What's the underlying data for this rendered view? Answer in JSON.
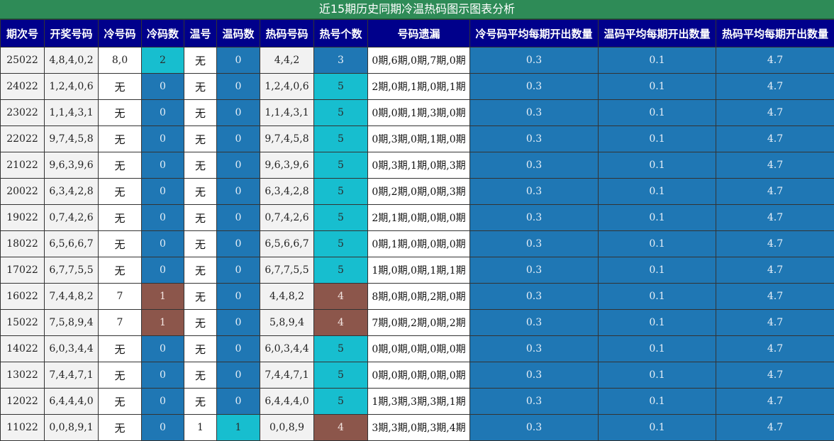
{
  "title": "近15期历史同期冷温热码图示图表分析",
  "colors": {
    "title_bg": "#2e8b57",
    "header_bg": "#00008b",
    "blue": "#1f77b4",
    "cyan": "#17becf",
    "brown": "#8c564b"
  },
  "headers": [
    "期次号",
    "开奖号码",
    "冷号码",
    "冷码数",
    "温号",
    "温码数",
    "热码号码",
    "热号个数",
    "号码遗漏",
    "冷号码平均每期开出数量",
    "温码平均每期开出数量",
    "热码平均每期开出数量"
  ],
  "rows": [
    {
      "issue": "25022",
      "numbers": "4,8,4,0,2",
      "cold": "8,0",
      "cold_count": "2",
      "warm": "无",
      "warm_count": "0",
      "hot": "4,4,2",
      "hot_count": "3",
      "missing": "0期,6期,0期,7期,0期",
      "avg_cold": "0.3",
      "avg_warm": "0.1",
      "avg_hot": "4.7"
    },
    {
      "issue": "24022",
      "numbers": "1,2,4,0,6",
      "cold": "无",
      "cold_count": "0",
      "warm": "无",
      "warm_count": "0",
      "hot": "1,2,4,0,6",
      "hot_count": "5",
      "missing": "2期,0期,1期,0期,1期",
      "avg_cold": "0.3",
      "avg_warm": "0.1",
      "avg_hot": "4.7"
    },
    {
      "issue": "23022",
      "numbers": "1,1,4,3,1",
      "cold": "无",
      "cold_count": "0",
      "warm": "无",
      "warm_count": "0",
      "hot": "1,1,4,3,1",
      "hot_count": "5",
      "missing": "0期,0期,1期,3期,0期",
      "avg_cold": "0.3",
      "avg_warm": "0.1",
      "avg_hot": "4.7"
    },
    {
      "issue": "22022",
      "numbers": "9,7,4,5,8",
      "cold": "无",
      "cold_count": "0",
      "warm": "无",
      "warm_count": "0",
      "hot": "9,7,4,5,8",
      "hot_count": "5",
      "missing": "0期,3期,0期,1期,0期",
      "avg_cold": "0.3",
      "avg_warm": "0.1",
      "avg_hot": "4.7"
    },
    {
      "issue": "21022",
      "numbers": "9,6,3,9,6",
      "cold": "无",
      "cold_count": "0",
      "warm": "无",
      "warm_count": "0",
      "hot": "9,6,3,9,6",
      "hot_count": "5",
      "missing": "0期,3期,1期,0期,3期",
      "avg_cold": "0.3",
      "avg_warm": "0.1",
      "avg_hot": "4.7"
    },
    {
      "issue": "20022",
      "numbers": "6,3,4,2,8",
      "cold": "无",
      "cold_count": "0",
      "warm": "无",
      "warm_count": "0",
      "hot": "6,3,4,2,8",
      "hot_count": "5",
      "missing": "0期,2期,0期,0期,3期",
      "avg_cold": "0.3",
      "avg_warm": "0.1",
      "avg_hot": "4.7"
    },
    {
      "issue": "19022",
      "numbers": "0,7,4,2,6",
      "cold": "无",
      "cold_count": "0",
      "warm": "无",
      "warm_count": "0",
      "hot": "0,7,4,2,6",
      "hot_count": "5",
      "missing": "2期,1期,0期,0期,0期",
      "avg_cold": "0.3",
      "avg_warm": "0.1",
      "avg_hot": "4.7"
    },
    {
      "issue": "18022",
      "numbers": "6,5,6,6,7",
      "cold": "无",
      "cold_count": "0",
      "warm": "无",
      "warm_count": "0",
      "hot": "6,5,6,6,7",
      "hot_count": "5",
      "missing": "0期,1期,0期,0期,0期",
      "avg_cold": "0.3",
      "avg_warm": "0.1",
      "avg_hot": "4.7"
    },
    {
      "issue": "17022",
      "numbers": "6,7,7,5,5",
      "cold": "无",
      "cold_count": "0",
      "warm": "无",
      "warm_count": "0",
      "hot": "6,7,7,5,5",
      "hot_count": "5",
      "missing": "1期,0期,0期,1期,1期",
      "avg_cold": "0.3",
      "avg_warm": "0.1",
      "avg_hot": "4.7"
    },
    {
      "issue": "16022",
      "numbers": "7,4,4,8,2",
      "cold": "7",
      "cold_count": "1",
      "warm": "无",
      "warm_count": "0",
      "hot": "4,4,8,2",
      "hot_count": "4",
      "missing": "8期,0期,0期,2期,0期",
      "avg_cold": "0.3",
      "avg_warm": "0.1",
      "avg_hot": "4.7"
    },
    {
      "issue": "15022",
      "numbers": "7,5,8,9,4",
      "cold": "7",
      "cold_count": "1",
      "warm": "无",
      "warm_count": "0",
      "hot": "5,8,9,4",
      "hot_count": "4",
      "missing": "7期,0期,2期,0期,2期",
      "avg_cold": "0.3",
      "avg_warm": "0.1",
      "avg_hot": "4.7"
    },
    {
      "issue": "14022",
      "numbers": "6,0,3,4,4",
      "cold": "无",
      "cold_count": "0",
      "warm": "无",
      "warm_count": "0",
      "hot": "6,0,3,4,4",
      "hot_count": "5",
      "missing": "0期,0期,0期,0期,0期",
      "avg_cold": "0.3",
      "avg_warm": "0.1",
      "avg_hot": "4.7"
    },
    {
      "issue": "13022",
      "numbers": "7,4,4,7,1",
      "cold": "无",
      "cold_count": "0",
      "warm": "无",
      "warm_count": "0",
      "hot": "7,4,4,7,1",
      "hot_count": "5",
      "missing": "0期,0期,0期,0期,0期",
      "avg_cold": "0.3",
      "avg_warm": "0.1",
      "avg_hot": "4.7"
    },
    {
      "issue": "12022",
      "numbers": "6,4,4,4,0",
      "cold": "无",
      "cold_count": "0",
      "warm": "无",
      "warm_count": "0",
      "hot": "6,4,4,4,0",
      "hot_count": "5",
      "missing": "1期,3期,3期,3期,1期",
      "avg_cold": "0.3",
      "avg_warm": "0.1",
      "avg_hot": "4.7"
    },
    {
      "issue": "11022",
      "numbers": "0,0,8,9,1",
      "cold": "无",
      "cold_count": "0",
      "warm": "1",
      "warm_count": "1",
      "hot": "0,0,8,9",
      "hot_count": "4",
      "missing": "3期,3期,0期,3期,4期",
      "avg_cold": "0.3",
      "avg_warm": "0.1",
      "avg_hot": "4.7"
    }
  ]
}
